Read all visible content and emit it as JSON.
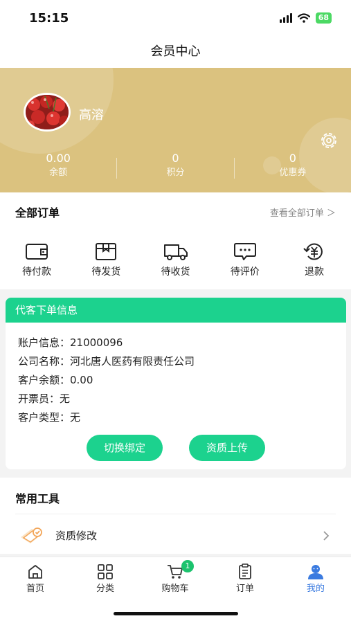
{
  "status_bar": {
    "time": "15:15",
    "battery": "68"
  },
  "nav": {
    "title": "会员中心"
  },
  "profile": {
    "username": "高溶",
    "stats": [
      {
        "value": "0.00",
        "label": "余额"
      },
      {
        "value": "0",
        "label": "积分"
      },
      {
        "value": "0",
        "label": "优惠券"
      }
    ]
  },
  "orders": {
    "title": "全部订单",
    "view_all": "查看全部订单 ＞",
    "items": [
      {
        "label": "待付款",
        "icon": "wallet-icon"
      },
      {
        "label": "待发货",
        "icon": "box-icon"
      },
      {
        "label": "待收货",
        "icon": "truck-icon"
      },
      {
        "label": "待评价",
        "icon": "comment-icon"
      },
      {
        "label": "退款",
        "icon": "refund-icon"
      }
    ]
  },
  "proxy": {
    "title": "代客下单信息",
    "lines": [
      "账户信息：21000096",
      "公司名称：河北唐人医药有限责任公司",
      "客户余额：0.00",
      "开票员：无",
      "客户类型：无"
    ],
    "switch_label": "切换绑定",
    "upload_label": "资质上传"
  },
  "tools": {
    "title": "常用工具",
    "items": [
      {
        "label": "资质修改",
        "icon": "document-edit-icon"
      }
    ]
  },
  "tabbar": {
    "items": [
      {
        "label": "首页",
        "icon": "home-icon"
      },
      {
        "label": "分类",
        "icon": "grid-icon"
      },
      {
        "label": "购物车",
        "icon": "cart-icon",
        "badge": "1"
      },
      {
        "label": "订单",
        "icon": "clipboard-icon"
      },
      {
        "label": "我的",
        "icon": "user-icon",
        "active": true
      }
    ],
    "active_color": "#3b7be0"
  },
  "colors": {
    "brand_green": "#1cd28e",
    "profile_bg": "#dbc27f",
    "badge_green": "#1cc36e"
  }
}
